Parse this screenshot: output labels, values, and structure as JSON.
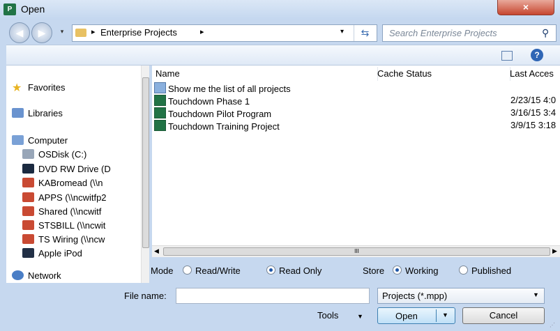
{
  "window": {
    "title": "Open",
    "app_icon_text": "P",
    "close_glyph": "×"
  },
  "address_bar": {
    "location": "Enterprise Projects",
    "separator": "▸",
    "back_glyph": "◀",
    "forward_glyph": "▶",
    "dropdown_glyph": "▾",
    "refresh_glyph": "⇆"
  },
  "search": {
    "placeholder": "Search Enterprise Projects",
    "icon_glyph": "⚲"
  },
  "toolbar": {
    "help_glyph": "?"
  },
  "nav_pane": {
    "items": [
      {
        "label": "Favorites",
        "icon": "star-icon"
      },
      {
        "label": "Libraries",
        "icon": "libraries-icon"
      },
      {
        "label": "Computer",
        "icon": "computer-icon"
      },
      {
        "label": "OSDisk (C:)",
        "icon": "disk-icon"
      },
      {
        "label": "DVD RW Drive (D",
        "icon": "dvd-icon"
      },
      {
        "label": "KABromead (\\\\n",
        "icon": "network-drive-icon"
      },
      {
        "label": "APPS (\\\\ncwitfp2",
        "icon": "network-drive-icon"
      },
      {
        "label": "Shared (\\\\ncwitf",
        "icon": "network-drive-icon"
      },
      {
        "label": "STSBILL (\\\\ncwit",
        "icon": "network-drive-icon"
      },
      {
        "label": "TS Wiring (\\\\ncw",
        "icon": "network-drive-icon"
      },
      {
        "label": "Apple iPod",
        "icon": "ipod-icon"
      },
      {
        "label": "Network",
        "icon": "network-icon"
      }
    ]
  },
  "file_list": {
    "columns": [
      "Name",
      "Cache Status",
      "Last Acces"
    ],
    "rows": [
      {
        "name": "Show me the list of all projects",
        "cache": "",
        "last_access": ""
      },
      {
        "name": "Touchdown Phase 1",
        "cache": "",
        "last_access": "2/23/15 4:0"
      },
      {
        "name": "Touchdown Pilot Program",
        "cache": "",
        "last_access": "3/16/15 3:4"
      },
      {
        "name": "Touchdown Training Project",
        "cache": "",
        "last_access": "3/9/15 3:18"
      }
    ],
    "hscroll_thumb_glyph": "III"
  },
  "options": {
    "mode_label": "Mode",
    "read_write": "Read/Write",
    "read_only": "Read Only",
    "store_label": "Store",
    "working": "Working",
    "published": "Published"
  },
  "bottom": {
    "file_name_label": "File name:",
    "file_name_value": "",
    "filter_value": "Projects (*.mpp)",
    "tools_label": "Tools",
    "open_label": "Open",
    "cancel_label": "Cancel"
  }
}
